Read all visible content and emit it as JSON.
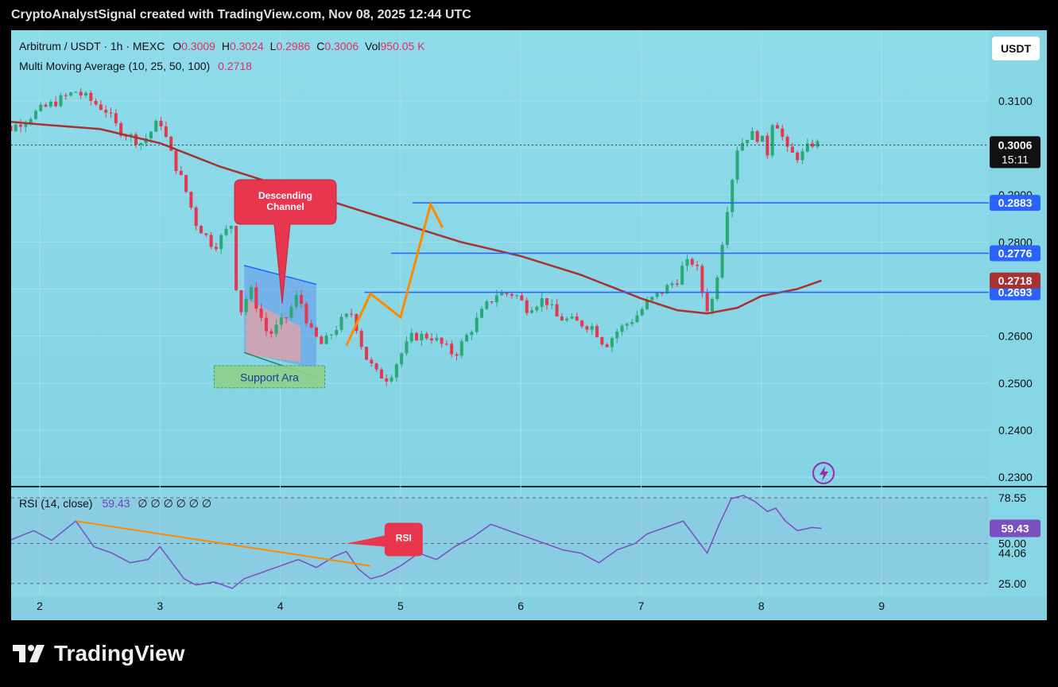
{
  "header": {
    "attribution": "CryptoAnalystSignal created with TradingView.com, Nov 08, 2025 12:44 UTC"
  },
  "legend": {
    "symbol": "Arbitrum / USDT · 1h · MEXC",
    "o_label": "O",
    "o_value": "0.3009",
    "h_label": "H",
    "h_value": "0.3024",
    "l_label": "L",
    "l_value": "0.2986",
    "c_label": "C",
    "c_value": "0.3006",
    "vol_label": "Vol",
    "vol_value": "950.05 K",
    "ma_label": "Multi Moving Average (10, 25, 50, 100)",
    "ma_value": "0.2718"
  },
  "rsi_legend": {
    "label": "RSI (14, close)",
    "value": "59.43",
    "extra": "∅ ∅ ∅ ∅ ∅ ∅"
  },
  "currency_button": "USDT",
  "brand": "TradingView",
  "colors": {
    "up": "#2aa876",
    "down": "#e8364f",
    "ma": "#a83232",
    "level": "#2962ff",
    "arrow": "#ff8a00",
    "rsi": "#7b4fc0"
  },
  "chart_data": [
    {
      "type": "candlestick",
      "title": "Arbitrum / USDT · 1h · MEXC",
      "x_ticks": [
        "2",
        "3",
        "4",
        "5",
        "6",
        "7",
        "8",
        "9"
      ],
      "y_ticks": [
        "0.3100",
        "0.3000",
        "0.2900",
        "0.2800",
        "0.2700",
        "0.2600",
        "0.2500",
        "0.2400",
        "0.2300"
      ],
      "ylim": [
        0.228,
        0.325
      ],
      "last_price": {
        "value": "0.3006",
        "countdown": "15:11"
      },
      "price_levels": [
        {
          "label": "0.2883",
          "value": 0.2883,
          "from_day": 5.1
        },
        {
          "label": "0.2776",
          "value": 0.2776,
          "from_day": 4.92
        },
        {
          "label": "0.2693",
          "value": 0.2693,
          "from_day": 4.7
        }
      ],
      "ma_label": {
        "label": "0.2718",
        "value": 0.2718
      },
      "moving_average": [
        [
          1.55,
          0.306
        ],
        [
          2.0,
          0.305
        ],
        [
          2.5,
          0.304
        ],
        [
          3.0,
          0.301
        ],
        [
          3.5,
          0.296
        ],
        [
          4.0,
          0.292
        ],
        [
          4.5,
          0.288
        ],
        [
          5.0,
          0.284
        ],
        [
          5.5,
          0.28
        ],
        [
          6.0,
          0.277
        ],
        [
          6.5,
          0.273
        ],
        [
          7.0,
          0.268
        ],
        [
          7.3,
          0.2655
        ],
        [
          7.55,
          0.2648
        ],
        [
          7.8,
          0.266
        ],
        [
          8.0,
          0.2685
        ],
        [
          8.3,
          0.27
        ],
        [
          8.5,
          0.2718
        ]
      ],
      "price_path": [
        [
          1.55,
          0.306
        ],
        [
          1.75,
          0.304
        ],
        [
          2.0,
          0.308
        ],
        [
          2.3,
          0.312
        ],
        [
          2.55,
          0.308
        ],
        [
          2.65,
          0.304
        ],
        [
          2.85,
          0.301
        ],
        [
          3.0,
          0.306
        ],
        [
          3.1,
          0.298
        ],
        [
          3.2,
          0.292
        ],
        [
          3.3,
          0.284
        ],
        [
          3.45,
          0.279
        ],
        [
          3.6,
          0.284
        ],
        [
          3.65,
          0.264
        ],
        [
          3.75,
          0.27
        ],
        [
          3.9,
          0.26
        ],
        [
          4.05,
          0.264
        ],
        [
          4.15,
          0.269
        ],
        [
          4.25,
          0.261
        ],
        [
          4.35,
          0.258
        ],
        [
          4.5,
          0.263
        ],
        [
          4.6,
          0.265
        ],
        [
          4.7,
          0.256
        ],
        [
          4.8,
          0.252
        ],
        [
          4.9,
          0.251
        ],
        [
          5.0,
          0.256
        ],
        [
          5.1,
          0.26
        ],
        [
          5.25,
          0.26
        ],
        [
          5.45,
          0.256
        ],
        [
          5.6,
          0.262
        ],
        [
          5.7,
          0.266
        ],
        [
          5.8,
          0.269
        ],
        [
          5.95,
          0.269
        ],
        [
          6.05,
          0.266
        ],
        [
          6.2,
          0.268
        ],
        [
          6.3,
          0.264
        ],
        [
          6.45,
          0.263
        ],
        [
          6.6,
          0.262
        ],
        [
          6.7,
          0.258
        ],
        [
          6.8,
          0.261
        ],
        [
          6.95,
          0.264
        ],
        [
          7.05,
          0.267
        ],
        [
          7.2,
          0.27
        ],
        [
          7.3,
          0.272
        ],
        [
          7.35,
          0.275
        ],
        [
          7.45,
          0.276
        ],
        [
          7.5,
          0.27
        ],
        [
          7.55,
          0.266
        ],
        [
          7.6,
          0.268
        ],
        [
          7.65,
          0.276
        ],
        [
          7.72,
          0.288
        ],
        [
          7.8,
          0.3
        ],
        [
          7.9,
          0.303
        ],
        [
          8.0,
          0.302
        ],
        [
          8.05,
          0.299
        ],
        [
          8.1,
          0.307
        ],
        [
          8.15,
          0.304
        ],
        [
          8.22,
          0.299
        ],
        [
          8.32,
          0.298
        ],
        [
          8.42,
          0.301
        ],
        [
          8.5,
          0.3006
        ]
      ],
      "annotations": [
        {
          "text": "Descending Channel"
        },
        {
          "text": "Support Ara"
        }
      ]
    },
    {
      "type": "line",
      "title": "RSI (14, close)",
      "y_ticks": [
        "78.55",
        "50.00",
        "44.06",
        "25.00"
      ],
      "last_value": "59.43",
      "ylim": [
        17,
        85
      ],
      "series": [
        [
          1.55,
          56
        ],
        [
          1.75,
          52
        ],
        [
          1.95,
          58
        ],
        [
          2.1,
          52
        ],
        [
          2.3,
          64
        ],
        [
          2.45,
          48
        ],
        [
          2.6,
          44
        ],
        [
          2.75,
          38
        ],
        [
          2.9,
          40
        ],
        [
          3.0,
          48
        ],
        [
          3.1,
          38
        ],
        [
          3.2,
          28
        ],
        [
          3.3,
          24
        ],
        [
          3.45,
          26
        ],
        [
          3.6,
          22
        ],
        [
          3.7,
          28
        ],
        [
          3.85,
          32
        ],
        [
          4.0,
          36
        ],
        [
          4.15,
          40
        ],
        [
          4.3,
          35
        ],
        [
          4.45,
          42
        ],
        [
          4.55,
          45
        ],
        [
          4.65,
          34
        ],
        [
          4.75,
          28
        ],
        [
          4.85,
          30
        ],
        [
          5.0,
          36
        ],
        [
          5.15,
          44
        ],
        [
          5.3,
          40
        ],
        [
          5.45,
          48
        ],
        [
          5.6,
          54
        ],
        [
          5.75,
          62
        ],
        [
          5.9,
          58
        ],
        [
          6.05,
          54
        ],
        [
          6.2,
          50
        ],
        [
          6.35,
          46
        ],
        [
          6.5,
          44
        ],
        [
          6.65,
          38
        ],
        [
          6.8,
          46
        ],
        [
          6.95,
          50
        ],
        [
          7.05,
          56
        ],
        [
          7.2,
          60
        ],
        [
          7.35,
          64
        ],
        [
          7.45,
          54
        ],
        [
          7.55,
          44
        ],
        [
          7.65,
          62
        ],
        [
          7.75,
          78
        ],
        [
          7.85,
          80
        ],
        [
          7.95,
          76
        ],
        [
          8.05,
          70
        ],
        [
          8.12,
          72
        ],
        [
          8.2,
          64
        ],
        [
          8.3,
          58
        ],
        [
          8.42,
          60
        ],
        [
          8.5,
          59.43
        ]
      ],
      "trend_line": [
        [
          2.3,
          64
        ],
        [
          4.75,
          36
        ]
      ],
      "annotations": [
        {
          "text": "RSI"
        }
      ]
    }
  ]
}
